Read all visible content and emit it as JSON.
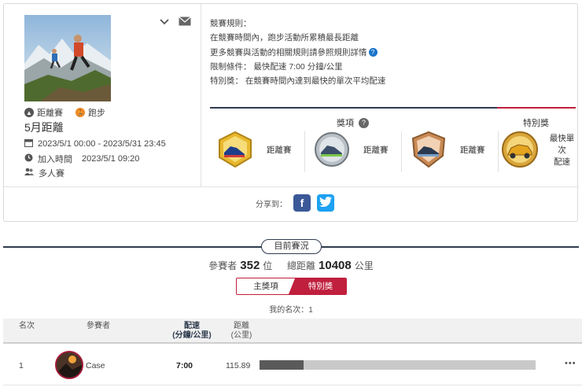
{
  "event": {
    "type_label": "距離賽",
    "sport_label": "跑步",
    "title": "5月距離",
    "date_range": "2023/5/1 00:00 - 2023/5/31 23:45",
    "join_label": "加入時間",
    "join_time": "2023/5/1 09:20",
    "mode": "多人賽"
  },
  "rules": {
    "heading": "競賽規則：",
    "line1": "在競賽時間內，跑步活動所累積最長距離",
    "line2": "更多競賽與活動的相關規則請參照規則詳情",
    "limit_label": "限制條件：",
    "limit_value": "最快配速 7:00 分鐘/公里",
    "special_label": "特別獎：",
    "special_value": "在競賽時間內達到最快的單次平均配速"
  },
  "awards": {
    "title": "獎項",
    "special_title": "特別獎",
    "items": [
      {
        "label": "距離賽",
        "badge": "gold-shoe-badge"
      },
      {
        "label": "距離賽",
        "badge": "silver-shoe-badge"
      },
      {
        "label": "距離賽",
        "badge": "bronze-shoe-badge"
      }
    ],
    "special": {
      "label_line1": "最快單次",
      "label_line2": "配速",
      "badge": "gold-car-badge"
    }
  },
  "share": {
    "label": "分享到：",
    "facebook": "f",
    "twitter": "t"
  },
  "status": {
    "title": "目前賽況",
    "participants_label": "參賽者",
    "participants": "352",
    "participants_unit": "位",
    "distance_label": "總距離",
    "distance": "10408",
    "distance_unit": "公里",
    "tab_main": "主獎項",
    "tab_special": "特別獎",
    "my_rank_label": "我的名次：",
    "my_rank": "1"
  },
  "table": {
    "col_rank": "名次",
    "col_participant": "參賽者",
    "col_pace": "配速",
    "col_pace_unit": "(分鐘/公里)",
    "col_distance": "距離",
    "col_distance_unit": "(公里)",
    "rows": [
      {
        "rank": "1",
        "name": "Case",
        "pace": "7:00",
        "distance": "115.89",
        "progress": 0.16,
        "more": "•••"
      }
    ]
  },
  "colors": {
    "navy": "#2e3b4e",
    "accent": "#c01f3d",
    "facebook": "#3b5998",
    "twitter": "#1da1f2"
  }
}
